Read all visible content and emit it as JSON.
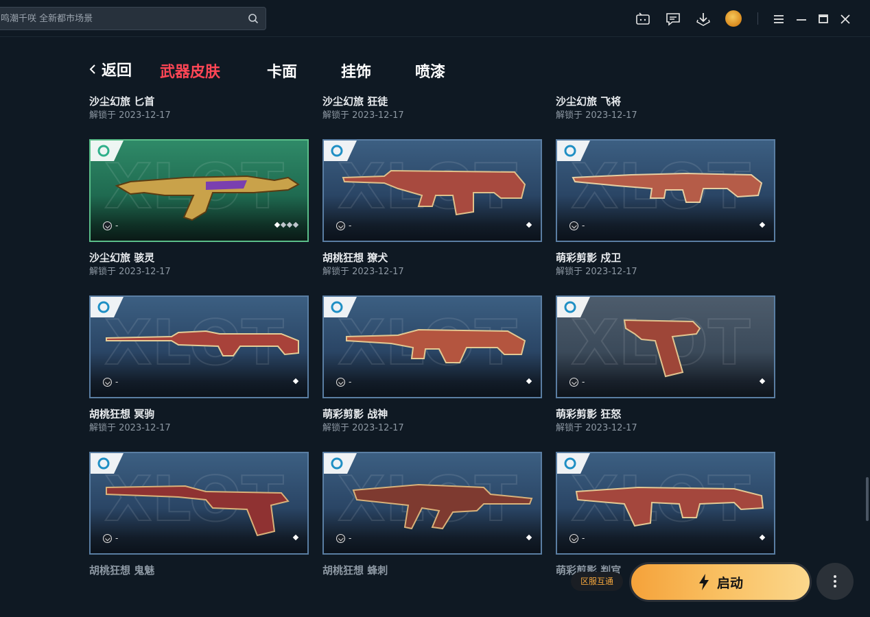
{
  "search": {
    "placeholder": "鸣潮千咲 全新都市场景"
  },
  "nav": {
    "back_label": "返回",
    "tabs": [
      {
        "label": "武器皮肤",
        "active": true
      },
      {
        "label": "卡面",
        "active": false
      },
      {
        "label": "挂饰",
        "active": false
      },
      {
        "label": "喷漆",
        "active": false
      }
    ]
  },
  "top_row": [
    {
      "name": "沙尘幻旅 匕首",
      "date": "解锁于 2023-12-17"
    },
    {
      "name": "沙尘幻旅 狂徒",
      "date": "解锁于 2023-12-17"
    },
    {
      "name": "沙尘幻旅 飞将",
      "date": "解锁于 2023-12-17"
    }
  ],
  "cards": [
    {
      "name": "沙尘幻旅 骇灵",
      "date": "解锁于 2023-12-17",
      "rank": "-",
      "style": "green",
      "levels": 4,
      "level": 1
    },
    {
      "name": "胡桃狂想 獠犬",
      "date": "解锁于 2023-12-17",
      "rank": "-",
      "style": "blue",
      "levels": 1,
      "level": 1
    },
    {
      "name": "萌彩剪影 戍卫",
      "date": "解锁于 2023-12-17",
      "rank": "-",
      "style": "blue",
      "levels": 1,
      "level": 1
    },
    {
      "name": "胡桃狂想 冥驹",
      "date": "解锁于 2023-12-17",
      "rank": "-",
      "style": "blue",
      "levels": 1,
      "level": 1
    },
    {
      "name": "萌彩剪影 战神",
      "date": "解锁于 2023-12-17",
      "rank": "-",
      "style": "blue",
      "levels": 1,
      "level": 1
    },
    {
      "name": "萌彩剪影 狂怒",
      "date": "解锁于 2023-12-17",
      "rank": "-",
      "style": "gray",
      "levels": 1,
      "level": 1
    },
    {
      "name": "胡桃狂想 鬼魅",
      "date": "",
      "rank": "-",
      "style": "blue",
      "levels": 1,
      "level": 1
    },
    {
      "name": "胡桃狂想 蜂刺",
      "date": "",
      "rank": "-",
      "style": "blue",
      "levels": 1,
      "level": 1
    },
    {
      "name": "萌彩剪影 判官",
      "date": "",
      "rank": "-",
      "style": "blue",
      "levels": 1,
      "level": 1
    }
  ],
  "bottom": {
    "badge": "区服互通",
    "launch_label": "启动"
  },
  "colors": {
    "accent_red": "#ff4655",
    "launch_orange": "#f5a23a",
    "background": "#0f1923"
  }
}
